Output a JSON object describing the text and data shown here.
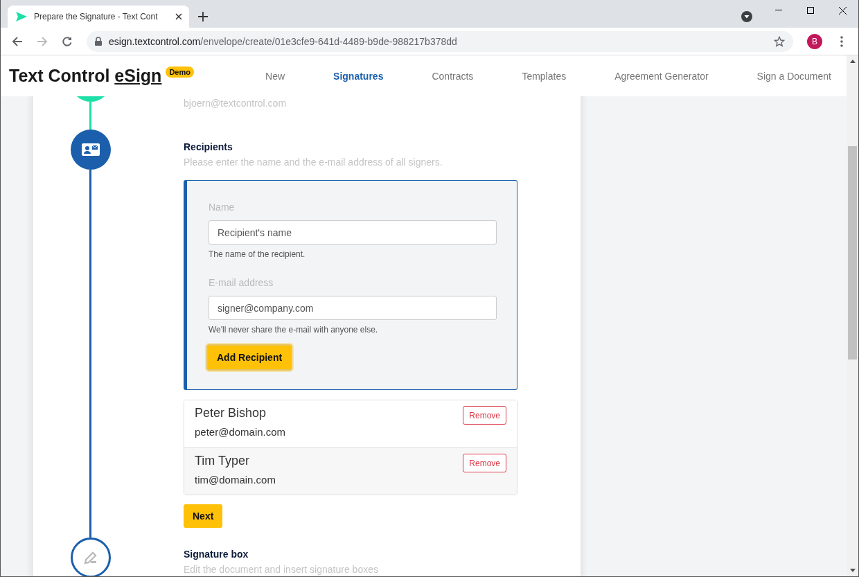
{
  "browser": {
    "tab_title": "Prepare the Signature - Text Cont",
    "url_host": "esign.textcontrol.com",
    "url_path": "/envelope/create/01e3cfe9-641d-4489-b9de-988217b378dd",
    "profile_initial": "B"
  },
  "site": {
    "logo": "Text Control",
    "logo_link": "eSign",
    "badge": "Demo",
    "nav": [
      {
        "label": "New",
        "selected": false
      },
      {
        "label": "Signatures",
        "selected": true
      },
      {
        "label": "Contracts",
        "selected": false
      },
      {
        "label": "Templates",
        "selected": false
      },
      {
        "label": "Agreement Generator",
        "selected": false
      },
      {
        "label": "Sign a Document",
        "selected": false
      }
    ]
  },
  "steps": [
    {
      "kind": "done",
      "note": "bjoern@textcontrol.com"
    },
    {
      "kind": "active",
      "title": "Recipients",
      "subtitle": "Please enter the name and the e-mail address of all signers.",
      "form": {
        "fields": [
          {
            "label": "Name",
            "placeholder": "Recipient's name",
            "help": "The name of the recipient."
          },
          {
            "label": "E-mail address",
            "placeholder": "signer@company.com",
            "help": "We'll never share the e-mail with anyone else."
          }
        ],
        "button": "Add Recipient"
      },
      "recipients": [
        {
          "name": "Peter Bishop",
          "email": "peter@domain.com",
          "remove": "Remove"
        },
        {
          "name": "Tim Typer",
          "email": "tim@domain.com",
          "remove": "Remove"
        }
      ],
      "next_button": "Next"
    },
    {
      "kind": "pending",
      "title": "Signature box",
      "subtitle": "Edit the document and insert signature boxes"
    }
  ]
}
